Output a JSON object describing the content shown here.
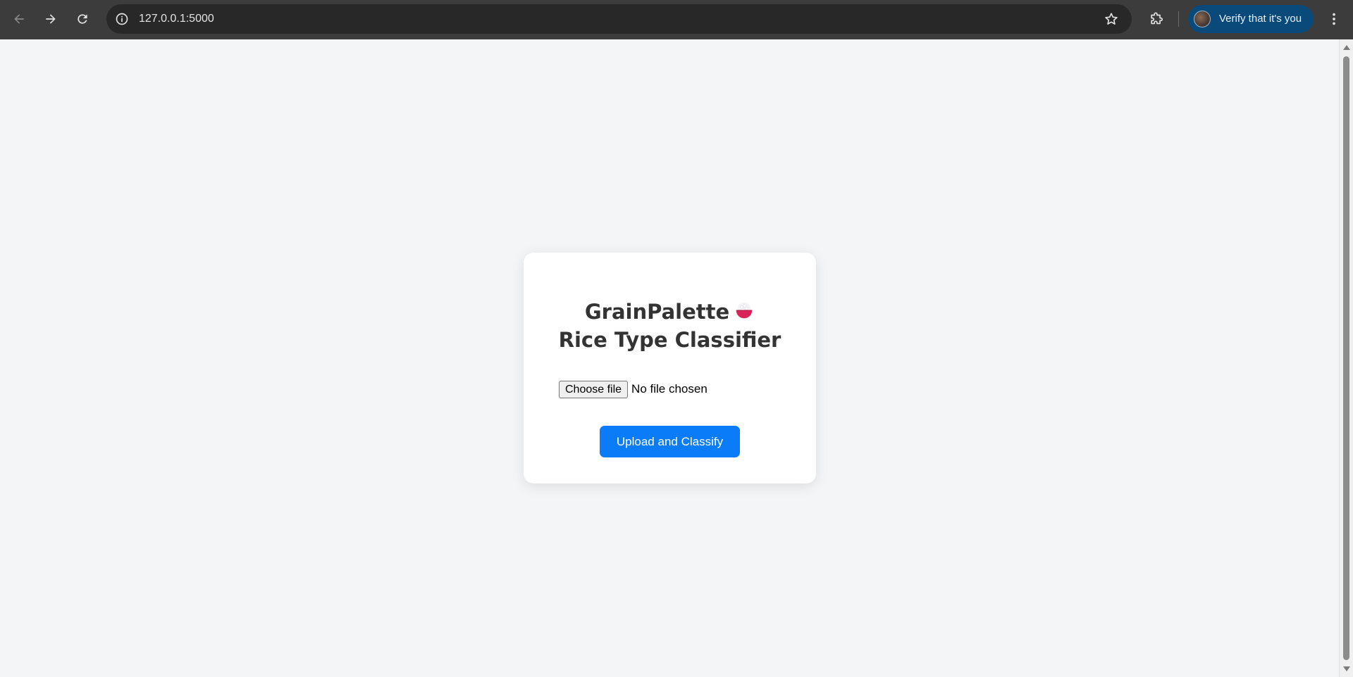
{
  "browser": {
    "url": "127.0.0.1:5000",
    "profile_chip_label": "Verify that it's you",
    "icons": {
      "back": "arrow-left",
      "forward": "arrow-right",
      "reload": "reload",
      "site_info": "info",
      "bookmark": "star",
      "extensions": "puzzle",
      "menu": "three-dots-vertical"
    },
    "colors": {
      "toolbar": "#3c3c3c",
      "omnibox": "#282828",
      "profile_chip": "#0a4a7a"
    }
  },
  "page": {
    "background": "#f4f5f7",
    "card": {
      "title_line1": "GrainPalette",
      "title_line2": "Rice Type Classifier",
      "title_icon": "rice-bowl-emoji",
      "file_input": {
        "button_label": "Choose file",
        "status_text": "No file chosen"
      },
      "submit_label": "Upload and Classify",
      "accent": "#0a7cf7"
    }
  }
}
